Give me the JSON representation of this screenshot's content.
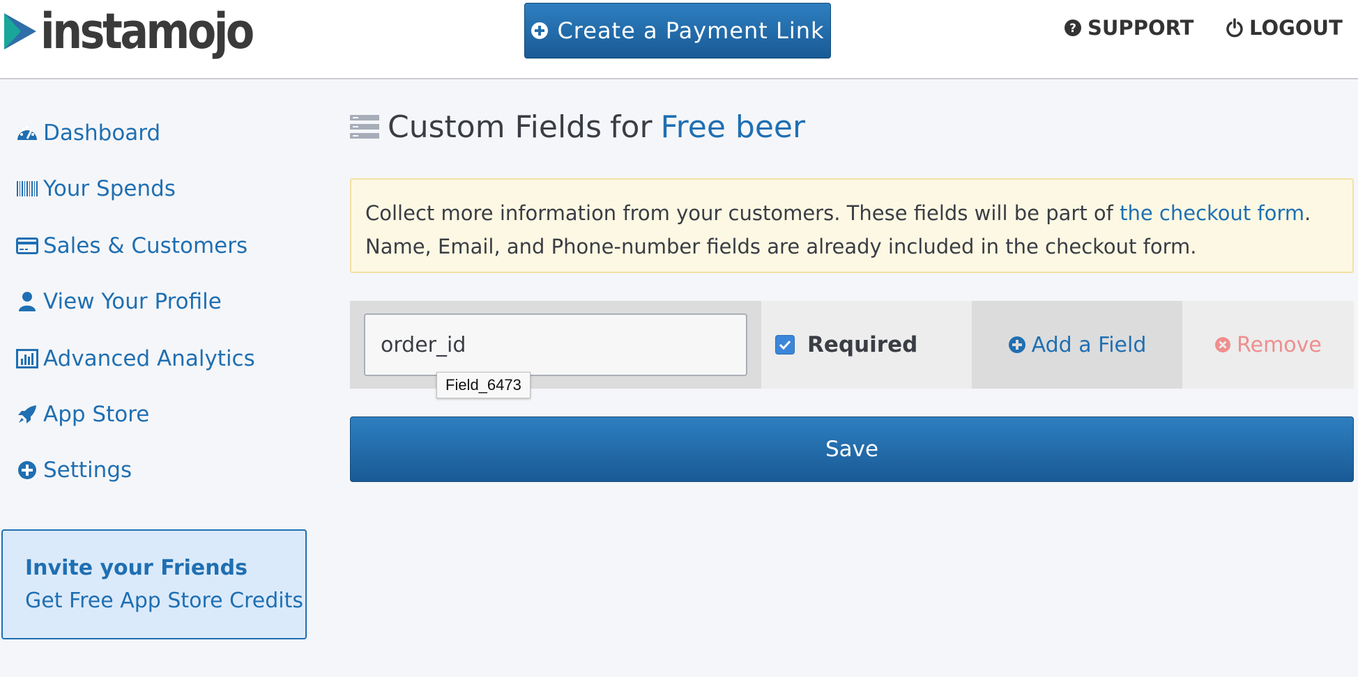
{
  "header": {
    "logo_text": "instamojo",
    "create_button_label": "Create a Payment Link",
    "support_label": "SUPPORT",
    "logout_label": "LOGOUT"
  },
  "sidebar": {
    "items": [
      {
        "label": "Dashboard",
        "icon": "dashboard-icon"
      },
      {
        "label": "Your Spends",
        "icon": "barcode-icon"
      },
      {
        "label": "Sales & Customers",
        "icon": "credit-card-icon"
      },
      {
        "label": "View Your Profile",
        "icon": "user-icon"
      },
      {
        "label": "Advanced Analytics",
        "icon": "bar-chart-icon"
      },
      {
        "label": "App Store",
        "icon": "rocket-icon"
      },
      {
        "label": "Settings",
        "icon": "plus-circle-icon"
      }
    ],
    "invite": {
      "title": "Invite your Friends",
      "subtitle": "Get Free App Store Credits"
    }
  },
  "main": {
    "title": "Custom Fields",
    "title_for": "for",
    "product_name": "Free beer",
    "info": {
      "text_before_link": "Collect more information from your customers. These fields will be part of ",
      "link_text": "the checkout form",
      "text_after_link": ".",
      "line2": "Name, Email, and Phone-number fields are already included in the checkout form."
    },
    "field": {
      "value": "order_id",
      "tooltip": "Field_6473",
      "required_label": "Required",
      "required_checked": true
    },
    "add_field_label": "Add a Field",
    "remove_label": "Remove",
    "save_label": "Save"
  },
  "colors": {
    "accent": "#1f6fb2",
    "button": "#1f64a3",
    "remove": "#ef8e8e",
    "info_bg": "#fcf8e3"
  }
}
